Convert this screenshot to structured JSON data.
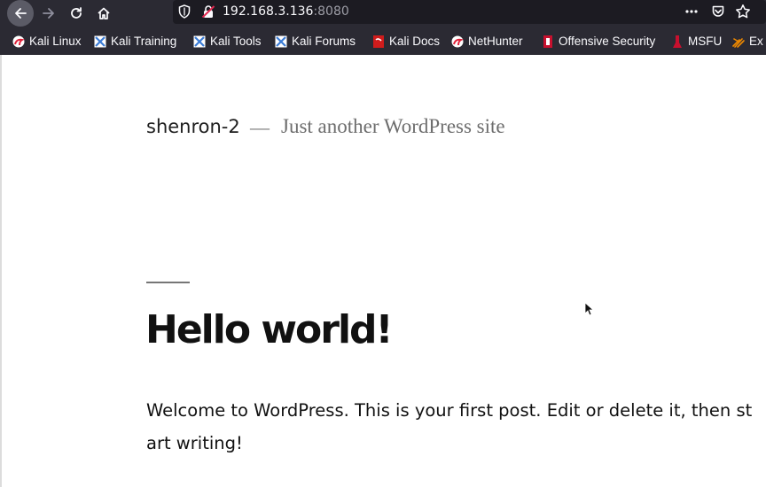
{
  "browser": {
    "url_host": "192.168.3.136",
    "url_port": ":8080"
  },
  "bookmarks": [
    {
      "label": "Kali Linux",
      "icon": "kali-dragon-icon",
      "color": "#e0223a"
    },
    {
      "label": "Kali Training",
      "icon": "kali-training-icon",
      "color": "#3a7bd5"
    },
    {
      "label": "Kali Tools",
      "icon": "kali-tools-icon",
      "color": "#3a7bd5"
    },
    {
      "label": "Kali Forums",
      "icon": "kali-forums-icon",
      "color": "#3a7bd5"
    },
    {
      "label": "Kali Docs",
      "icon": "kali-docs-icon",
      "color": "#d01c1c"
    },
    {
      "label": "NetHunter",
      "icon": "nethunter-icon",
      "color": "#e0223a"
    },
    {
      "label": "Offensive Security",
      "icon": "offsec-icon",
      "color": "#c8102e"
    },
    {
      "label": "MSFU",
      "icon": "msfu-icon",
      "color": "#c8102e"
    },
    {
      "label": "Ex",
      "icon": "exploit-db-icon",
      "color": "#f08a00"
    }
  ],
  "site": {
    "title": "shenron-2",
    "dash": "—",
    "tagline": "Just another WordPress site"
  },
  "post": {
    "title": "Hello world!",
    "content": "Welcome to WordPress. This is your first post. Edit or delete it, then start writing!"
  }
}
